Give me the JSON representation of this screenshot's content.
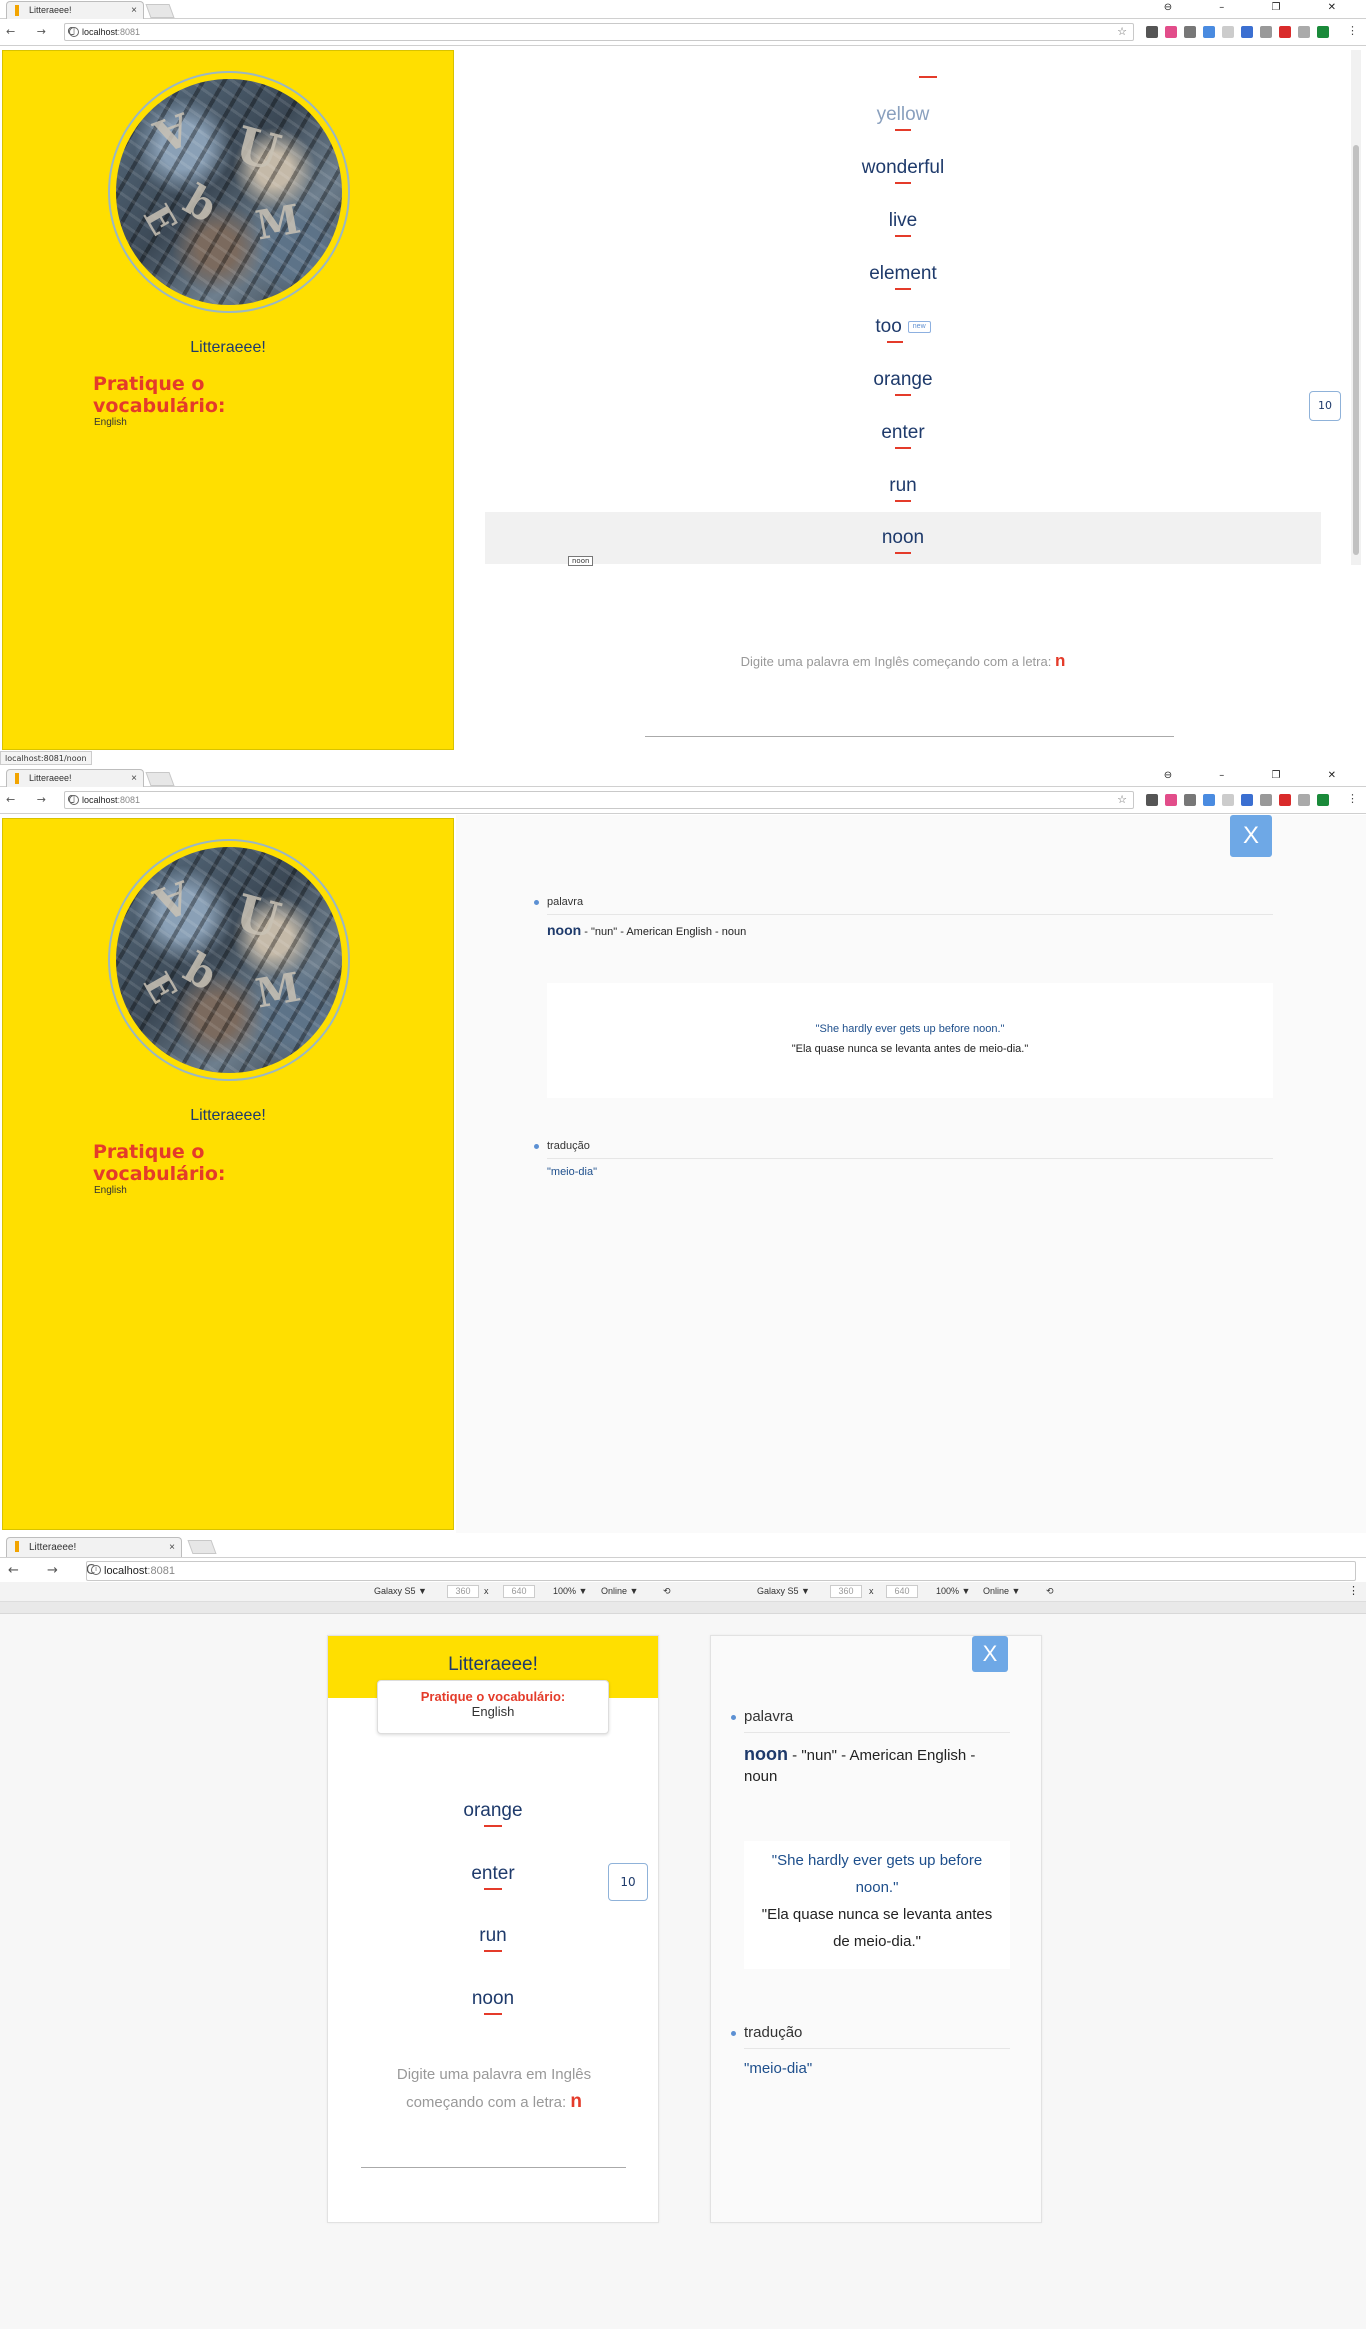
{
  "browser": {
    "tab_title": "Litteraeee!",
    "tab_close": "×",
    "url_host": "localhost",
    "url_port": ":8081",
    "window_controls": "⊖ – ❐ ✕",
    "nav_buttons": "← → C",
    "status_url": "localhost:8081/noon"
  },
  "sidebar": {
    "app_name": "Litteraeee!",
    "practice_label": "Pratique o vocabulário:",
    "language": "English"
  },
  "word_list": {
    "words": [
      {
        "text": "yellow",
        "state": "faded"
      },
      {
        "text": "wonderful"
      },
      {
        "text": "live"
      },
      {
        "text": "element"
      },
      {
        "text": "too",
        "badge": "new"
      },
      {
        "text": "orange"
      },
      {
        "text": "enter"
      },
      {
        "text": "run"
      },
      {
        "text": "noon",
        "state": "highlighted",
        "tooltip": "noon"
      }
    ],
    "counter": "10"
  },
  "prompt": {
    "text": "Digite uma palavra em Inglês começando com a letra:",
    "letter": "n"
  },
  "detail": {
    "close_label": "X",
    "word_section_label": "palavra",
    "word": "noon",
    "pronunciation": "\"nun\"",
    "variant": "American English",
    "part_of_speech": "noun",
    "separator": " - ",
    "example_en": "\"She hardly ever gets up before noon.\"",
    "example_pt": "\"Ela quase nunca se levanta antes de meio-dia.\"",
    "translation_section_label": "tradução",
    "translation": "\"meio-dia\""
  },
  "devtools": {
    "device": "Galaxy S5 ▼",
    "width": "360",
    "times": "x",
    "height": "640",
    "zoom": "100% ▼",
    "network": "Online ▼",
    "rotate_icon": "⟲"
  },
  "mobile_words": [
    "orange",
    "enter",
    "run",
    "noon"
  ],
  "colors": {
    "sidebar_bg": "#ffdf00",
    "accent_red": "#e43b2a",
    "word_blue": "#1e3a6b",
    "close_button": "#6ea8e6"
  }
}
